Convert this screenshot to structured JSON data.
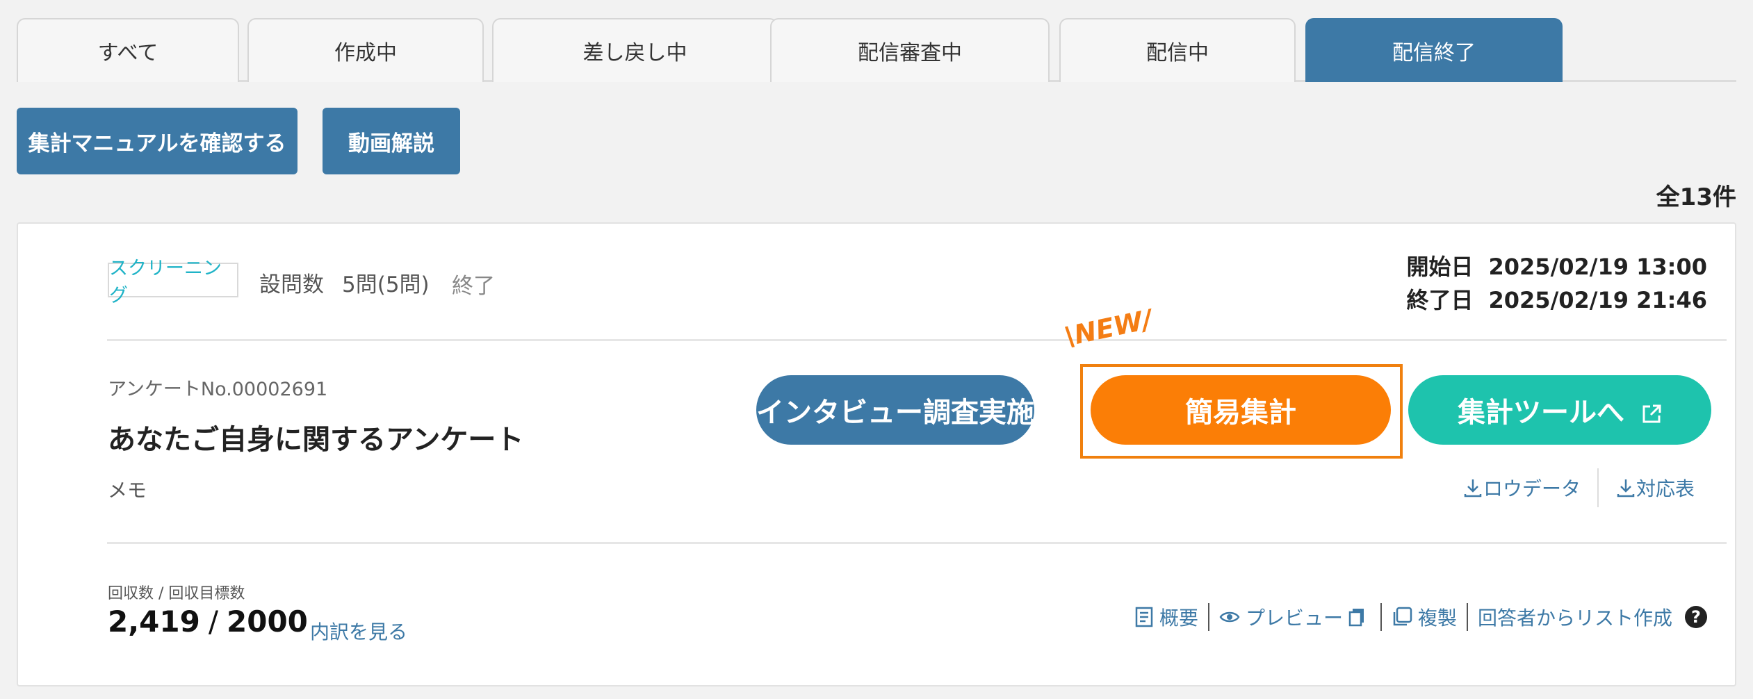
{
  "tabs": [
    {
      "label": "すべて"
    },
    {
      "label": "作成中"
    },
    {
      "label": "差し戻し中"
    },
    {
      "label": "配信審査中"
    },
    {
      "label": "配信中"
    },
    {
      "label": "配信終了"
    }
  ],
  "active_tab": "配信終了",
  "toolbar": {
    "manual_button": "集計マニュアルを確認する",
    "video_button": "動画解説",
    "total_count": "全13件"
  },
  "survey": {
    "badge": "スクリーニング",
    "question_count_label": "設問数",
    "question_count": "5問(5問)",
    "status": "終了",
    "start_label": "開始日",
    "start_date": "2025/02/19 13:00",
    "end_label": "終了日",
    "end_date": "2025/02/19 21:46",
    "number": "アンケートNo.00002691",
    "title": "あなたご自身に関するアンケート",
    "memo": "メモ",
    "new_tag": "\\NEW/",
    "buttons": {
      "interview": "インタビュー調査実施",
      "simple_summary": "簡易集計",
      "summary_tool": "集計ツールへ"
    },
    "downloads": {
      "raw_data": "ロウデータ",
      "mapping": "対応表"
    },
    "responses_label": "回収数 / 回収目標数",
    "responses_collected": "2,419",
    "responses_separator": "/",
    "responses_target": "2000",
    "breakdown_link": "内訳を見る",
    "actions": {
      "overview": "概要",
      "preview": "プレビュー",
      "duplicate": "複製",
      "make_list": "回答者からリスト作成"
    },
    "help_symbol": "?"
  },
  "colors": {
    "primary": "#3d79a6",
    "orange": "#fb7e06",
    "teal": "#1ec3ad",
    "badge_text": "#1fb3c7"
  },
  "icons": [
    "external-link-icon",
    "download-icon",
    "document-icon",
    "eye-icon",
    "copy-icon",
    "help-icon"
  ]
}
